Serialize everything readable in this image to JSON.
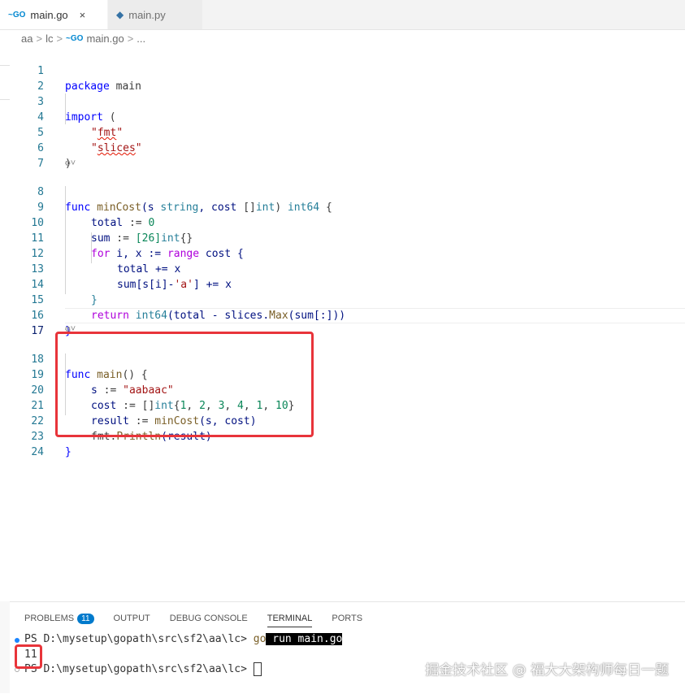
{
  "tabs": [
    {
      "icon": "~GO",
      "label": "main.go",
      "close": "×"
    },
    {
      "icon": "◆",
      "label": "main.py"
    }
  ],
  "breadcrumb": [
    "aa",
    "lc",
    "main.go",
    "..."
  ],
  "breadcrumb_icon": "~GO",
  "codelens_text": "⚙˅",
  "line_numbers": [
    "1",
    "2",
    "3",
    "4",
    "5",
    "6",
    "7",
    "8",
    "9",
    "10",
    "11",
    "12",
    "13",
    "14",
    "15",
    "16",
    "17",
    "18",
    "19",
    "20",
    "21",
    "22",
    "23",
    "24"
  ],
  "code": {
    "l1": [
      "package",
      " main"
    ],
    "l3": [
      "import",
      " ("
    ],
    "l4": [
      "\"",
      "fmt",
      "\""
    ],
    "l5": [
      "\"",
      "slices",
      "\""
    ],
    "l6": [
      ")"
    ],
    "l8": [
      "func",
      " ",
      "minCost",
      "(s ",
      "string",
      ", cost ",
      "[]",
      "int",
      ") ",
      "int64",
      " {"
    ],
    "l9": [
      "total",
      " := ",
      "0"
    ],
    "l10": [
      "sum",
      " := ",
      "[26]",
      "int",
      "{}"
    ],
    "l11": [
      "for",
      " i, x := ",
      "range",
      " cost {"
    ],
    "l12": [
      "total",
      " += x"
    ],
    "l13": [
      "sum",
      "[s[i]-",
      "'a'",
      "] += x"
    ],
    "l14": [
      "}"
    ],
    "l15": [
      "return",
      " ",
      "int64",
      "(total - slices.",
      "Max",
      "(sum[:]))"
    ],
    "l16": [
      "}"
    ],
    "l18": [
      "func",
      " ",
      "main",
      "() {"
    ],
    "l19": [
      "s",
      " := ",
      "\"aabaac\""
    ],
    "l20": [
      "cost",
      " := ",
      "[]",
      "int",
      "{",
      "1",
      ", ",
      "2",
      ", ",
      "3",
      ", ",
      "4",
      ", ",
      "1",
      ", ",
      "10",
      "}"
    ],
    "l21": [
      "result",
      " := ",
      "minCost",
      "(s, cost)"
    ],
    "l22": [
      "fmt.",
      "Println",
      "(result)"
    ],
    "l23": [
      "}"
    ]
  },
  "panel": {
    "tabs": [
      "PROBLEMS",
      "OUTPUT",
      "DEBUG CONSOLE",
      "TERMINAL",
      "PORTS"
    ],
    "problems_count": "11",
    "active_tab": "TERMINAL"
  },
  "terminal": {
    "prompt": "PS D:\\mysetup\\gopath\\src\\sf2\\aa\\lc> ",
    "cmd_go": "go",
    "cmd_rest": " run main.go",
    "output": "11"
  },
  "watermark": "掘金技术社区 @ 福大大架构师每日一题",
  "colors": {
    "keyword": "#0000ff",
    "control": "#af00db",
    "string": "#a31515",
    "type": "#267f99",
    "function": "#795e26",
    "number": "#098658",
    "variable": "#001080",
    "highlight_box": "#e8343a",
    "badge": "#007acc"
  }
}
